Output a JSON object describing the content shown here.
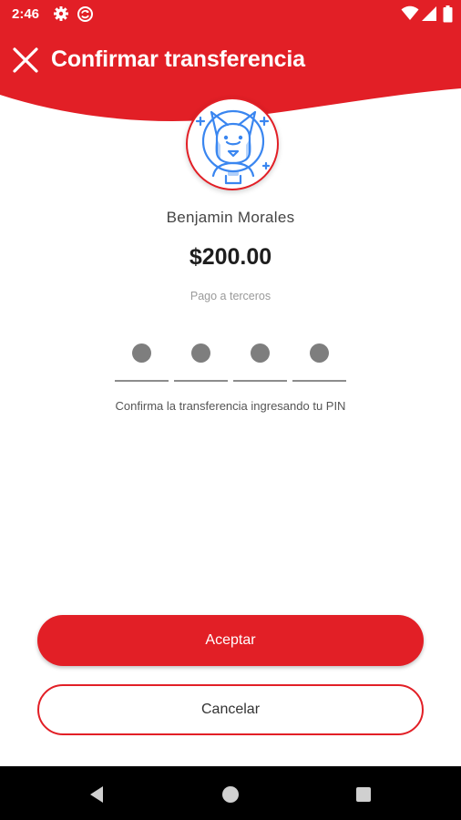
{
  "theme": {
    "accent": "#e21f26",
    "background": "#ffffff",
    "nav_bar": "#000000"
  },
  "status_bar": {
    "time": "2:46",
    "left_icons": [
      "gear-icon",
      "sync-icon"
    ],
    "right_icons": [
      "wifi-icon",
      "signal-icon",
      "battery-icon"
    ]
  },
  "header": {
    "title": "Confirmar transferencia",
    "close_icon": "close-icon"
  },
  "recipient": {
    "avatar_icon": "dog-astronaut-icon",
    "name": "Benjamin Morales"
  },
  "transfer": {
    "amount": "$200.00",
    "type": "Pago a terceros"
  },
  "pin": {
    "slots": 4,
    "filled": 4,
    "hint": "Confirma la transferencia ingresando tu PIN"
  },
  "buttons": {
    "accept_label": "Aceptar",
    "cancel_label": "Cancelar"
  },
  "nav_bar": {
    "icons": [
      "back-icon",
      "home-icon",
      "recents-icon"
    ]
  }
}
